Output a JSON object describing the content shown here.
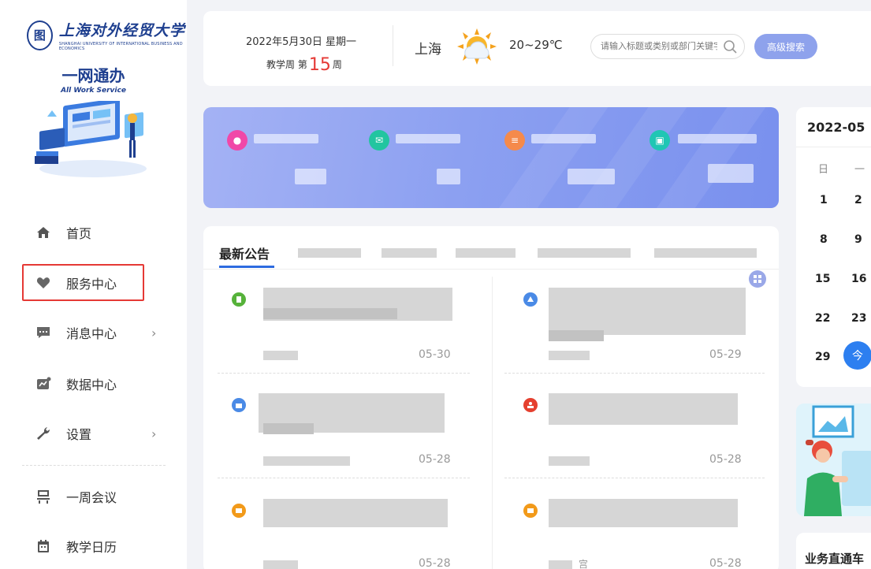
{
  "sidebar": {
    "logo_text": "上海对外经贸大学",
    "logo_en": "SHANGHAI UNIVERSITY OF INTERNATIONAL BUSINESS AND ECONOMICS",
    "product_cn": "一网通办",
    "product_en": "All Work Service",
    "menu": [
      {
        "label": "首页",
        "icon": "home-icon"
      },
      {
        "label": "服务中心",
        "icon": "heart-icon"
      },
      {
        "label": "消息中心",
        "icon": "message-icon",
        "arrow": "›"
      },
      {
        "label": "数据中心",
        "icon": "chart-icon"
      },
      {
        "label": "设置",
        "icon": "wrench-icon",
        "arrow": "›"
      },
      {
        "label": "一周会议",
        "icon": "meeting-icon"
      },
      {
        "label": "教学日历",
        "icon": "calendar-icon"
      }
    ]
  },
  "topbar": {
    "date": "2022年5月30日 星期一",
    "week_prefix": "教学周 第",
    "week_number": "15",
    "week_suffix": "周",
    "city": "上海",
    "temperature": "20~29℃",
    "search_placeholder": "请输入标题或类别或部门关键字",
    "advanced_search": "高级搜索"
  },
  "notices": {
    "active_tab": "最新公告",
    "items": [
      {
        "date": "05-30"
      },
      {
        "date": "05-29"
      },
      {
        "date": "05-28"
      },
      {
        "date": "05-28"
      },
      {
        "date": "05-28"
      },
      {
        "date": "05-28"
      }
    ],
    "partial_text": "宫"
  },
  "calendar": {
    "title": "2022-05",
    "weekdays": [
      "日",
      "一"
    ],
    "days": [
      [
        "1",
        "2"
      ],
      [
        "8",
        "9"
      ],
      [
        "15",
        "16"
      ],
      [
        "22",
        "23"
      ],
      [
        "29",
        "今"
      ]
    ]
  },
  "business": {
    "title": "业务直通车"
  },
  "colors": {
    "accent": "#2d6be0",
    "highlight_border": "#e53935",
    "banner": "#8a9ef0",
    "advanced_button": "#8ea2ec",
    "week_number": "#e53935"
  }
}
